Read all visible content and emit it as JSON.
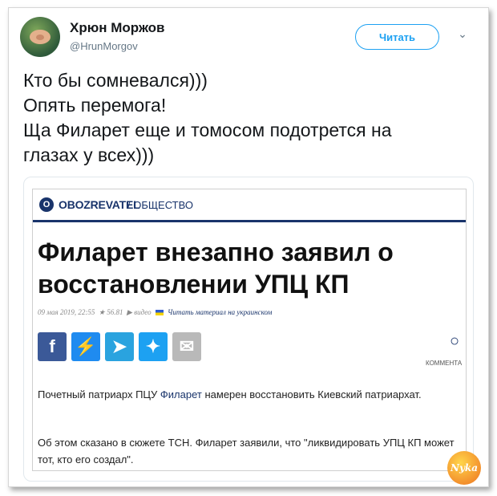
{
  "tweet": {
    "author_name": "Хрюн Моржов",
    "author_handle": "@HrunMorgov",
    "follow_label": "Читать",
    "text_lines": [
      "Кто бы сомневался)))",
      "Опять перемога!",
      "Ща Филарет еще и томосом подотрется на",
      "глазах у всех)))"
    ]
  },
  "article": {
    "publisher": "OBOZREVATEL",
    "section": "/ ОБЩЕСТВО",
    "headline_line1": "Филарет внезапно заявил о",
    "headline_line2": "восстановлении УПЦ КП",
    "meta_date": "09 мая 2019, 22:55",
    "meta_views": "56.81",
    "meta_video": "видео",
    "meta_link": "Читать материал на украинском",
    "comments_label": "КОММЕНТА",
    "paragraph1_before": "Почетный патриарх ПЦУ ",
    "paragraph1_link": "Филарет",
    "paragraph1_after": " намерен восстановить Киевский патриархат.",
    "paragraph2": "Об этом сказано в сюжете ТСН. Филарет заявили, что \"ликвидировать УПЦ КП может тот, кто его создал\"."
  },
  "watermark_text": "Nyka",
  "icons": [
    "avatar",
    "chevron-down-icon",
    "facebook-icon",
    "messenger-icon",
    "telegram-icon",
    "twitter-icon",
    "email-icon",
    "comment-icon"
  ]
}
